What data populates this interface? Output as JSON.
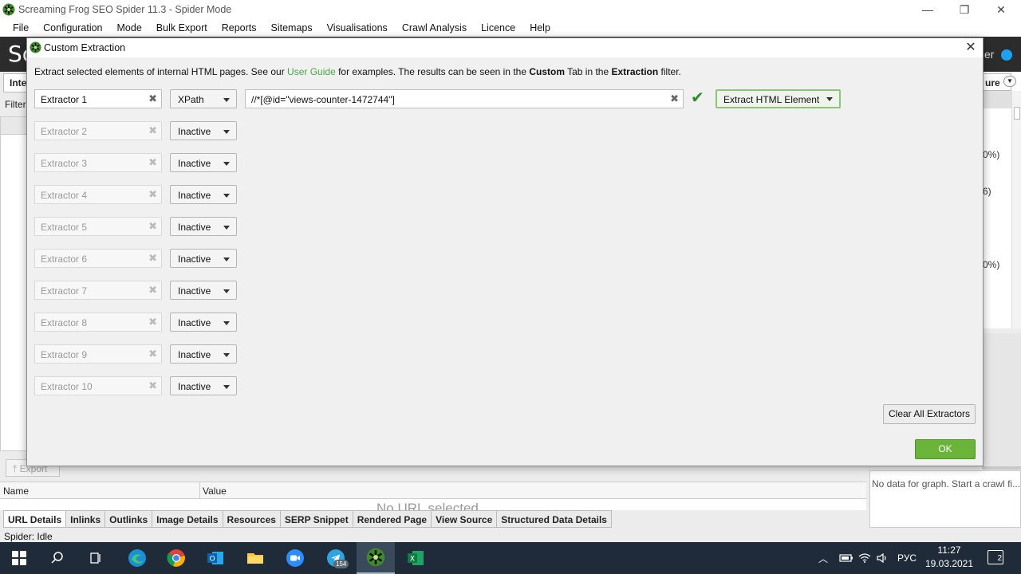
{
  "window": {
    "title": "Screaming Frog SEO Spider 11.3 - Spider Mode",
    "minimize": "—",
    "maximize": "❐",
    "close": "✕"
  },
  "menu": [
    "File",
    "Configuration",
    "Mode",
    "Bulk Export",
    "Reports",
    "Sitemaps",
    "Visualisations",
    "Crawl Analysis",
    "Licence",
    "Help"
  ],
  "background": {
    "logo_left": "Sc",
    "logo_right": "er",
    "left_tab": "Inte",
    "left_filter": "Filter",
    "right_tab": "ure",
    "percent_1": "0%)",
    "percent_2": "6)",
    "percent_3": "0%)",
    "export_label": "Export",
    "name_col": "Name",
    "value_col": "Value",
    "no_url": "No URL selected",
    "graph_message": "No data for graph. Start a crawl fi...",
    "bottom_tabs": [
      "URL Details",
      "Inlinks",
      "Outlinks",
      "Image Details",
      "Resources",
      "SERP Snippet",
      "Rendered Page",
      "View Source",
      "Structured Data Details"
    ],
    "status": "Spider: Idle"
  },
  "dialog": {
    "title": "Custom Extraction",
    "close": "✕",
    "intro_1": "Extract selected elements of internal HTML pages. See our ",
    "intro_link": "User Guide",
    "intro_2": " for examples. The results can be seen in the ",
    "intro_bold_1": "Custom",
    "intro_3": " Tab in the ",
    "intro_bold_2": "Extraction",
    "intro_4": " filter.",
    "extractors": [
      {
        "name": "Extractor 1",
        "mode": "XPath"
      },
      {
        "name": "Extractor 2",
        "mode": "Inactive"
      },
      {
        "name": "Extractor 3",
        "mode": "Inactive"
      },
      {
        "name": "Extractor 4",
        "mode": "Inactive"
      },
      {
        "name": "Extractor 5",
        "mode": "Inactive"
      },
      {
        "name": "Extractor 6",
        "mode": "Inactive"
      },
      {
        "name": "Extractor 7",
        "mode": "Inactive"
      },
      {
        "name": "Extractor 8",
        "mode": "Inactive"
      },
      {
        "name": "Extractor 9",
        "mode": "Inactive"
      },
      {
        "name": "Extractor 10",
        "mode": "Inactive"
      }
    ],
    "xpath_value": "//*[@id=\"views-counter-1472744\"]",
    "extract_type": "Extract HTML Element",
    "clear_all": "Clear All Extractors",
    "ok": "OK"
  },
  "taskbar": {
    "telegram_badge": "154",
    "language": "РУС",
    "time": "11:27",
    "date": "19.03.2021",
    "notifications": "2"
  },
  "colors": {
    "accent_green": "#6ab43a",
    "link_green": "#4aa84a",
    "taskbar": "#1f2b38"
  }
}
